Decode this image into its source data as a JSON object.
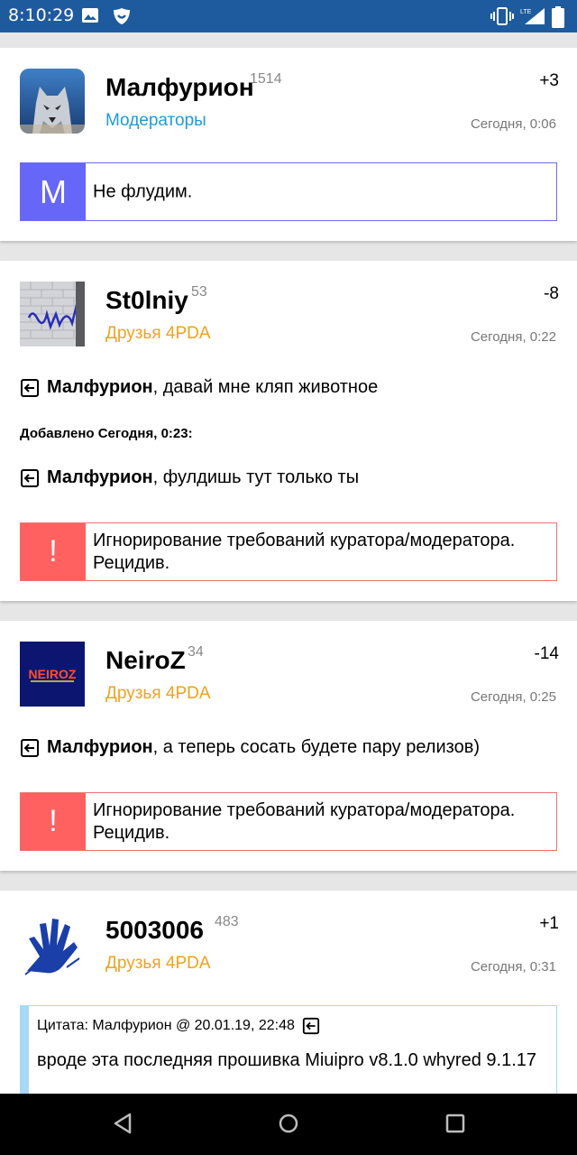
{
  "status_bar": {
    "time": "8:10:29"
  },
  "posts": [
    {
      "nick": "Малфурион",
      "reputation": "1514",
      "group": "Модераторы",
      "karma": "+3",
      "date": "Сегодня, 0:06",
      "notice": {
        "badge": "M",
        "text": "Не флудим."
      }
    },
    {
      "nick": "St0lniy",
      "reputation": "53",
      "group": "Друзья 4PDA",
      "karma": "-8",
      "date": "Сегодня, 0:22",
      "reply1_name": "Малфурион",
      "reply1_text": ", давай мне кляп животное",
      "added": "Добавлено Сегодня, 0:23:",
      "reply2_name": "Малфурион",
      "reply2_text": ", фулдишь тут только ты",
      "warning": {
        "badge": "!",
        "text": "Игнорирование требований куратора/модератора. Рецидив."
      }
    },
    {
      "nick": "NeiroZ",
      "reputation": "34",
      "group": "Друзья 4PDA",
      "karma": "-14",
      "date": "Сегодня, 0:25",
      "reply1_name": "Малфурион",
      "reply1_text": ", а теперь сосать будете пару релизов)",
      "warning": {
        "badge": "!",
        "text": "Игнорирование требований куратора/модератора. Рецидив."
      }
    },
    {
      "nick": "5003006",
      "reputation": "483",
      "group": "Друзья 4PDA",
      "karma": "+1",
      "date": "Сегодня, 0:31",
      "quote": {
        "header": "Цитата: Малфурион @ 20.01.19, 22:48",
        "text": "вроде эта последняя прошивка Miuipro v8.1.0 whyred 9.1.17"
      }
    }
  ],
  "colors": {
    "status_bar": "#1e5b9e",
    "moderator_group": "#1d9bdb",
    "friends_group": "#f0a21b",
    "moderator_notice": "#6666f9",
    "warning_notice": "#ff6161",
    "quote_border": "#a8d8f5"
  },
  "icons": [
    "gallery-icon",
    "shield-icon",
    "vibrate-icon",
    "signal-lte-icon",
    "battery-icon",
    "reply-icon",
    "back-nav-icon",
    "home-nav-icon",
    "recents-nav-icon"
  ]
}
